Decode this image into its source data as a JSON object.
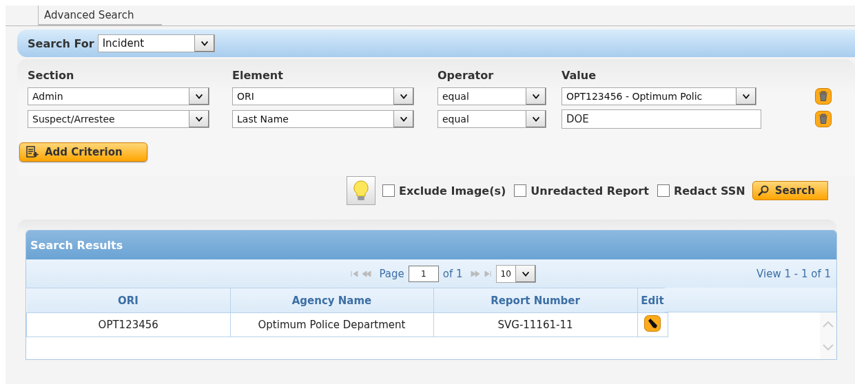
{
  "tab": {
    "label": "Advanced Search",
    "selected": true
  },
  "search_for": {
    "label": "Search For",
    "value": "Incident"
  },
  "criteria": {
    "columns": [
      "Section",
      "Element",
      "Operator",
      "Value"
    ],
    "rows": [
      {
        "section": "Admin",
        "element": "ORI",
        "operator": "equal",
        "value": "OPT123456 - Optimum Polic",
        "kind": "dropdown"
      },
      {
        "section": "Suspect/Arrestee",
        "element": "Last Name",
        "operator": "equal",
        "value": "DOE",
        "kind": "text"
      }
    ]
  },
  "add_button": "Add Criterion",
  "options": [
    {
      "label": "Exclude Image(s)",
      "checked": false
    },
    {
      "label": "Unredacted Report",
      "checked": false
    },
    {
      "label": "Redact SSN",
      "checked": false
    }
  ],
  "search_button": "Search",
  "results": {
    "title": "Search Results",
    "pager": {
      "page_label": "Page",
      "page": "1",
      "of": "of 1",
      "per_page": "10",
      "view": "View 1 - 1 of 1"
    },
    "columns": [
      "ORI",
      "Agency Name",
      "Report Number",
      "Edit"
    ],
    "rows": [
      {
        "cells": [
          "OPT123456",
          "Optimum Police Department",
          "SVG-11161-11"
        ]
      }
    ]
  }
}
